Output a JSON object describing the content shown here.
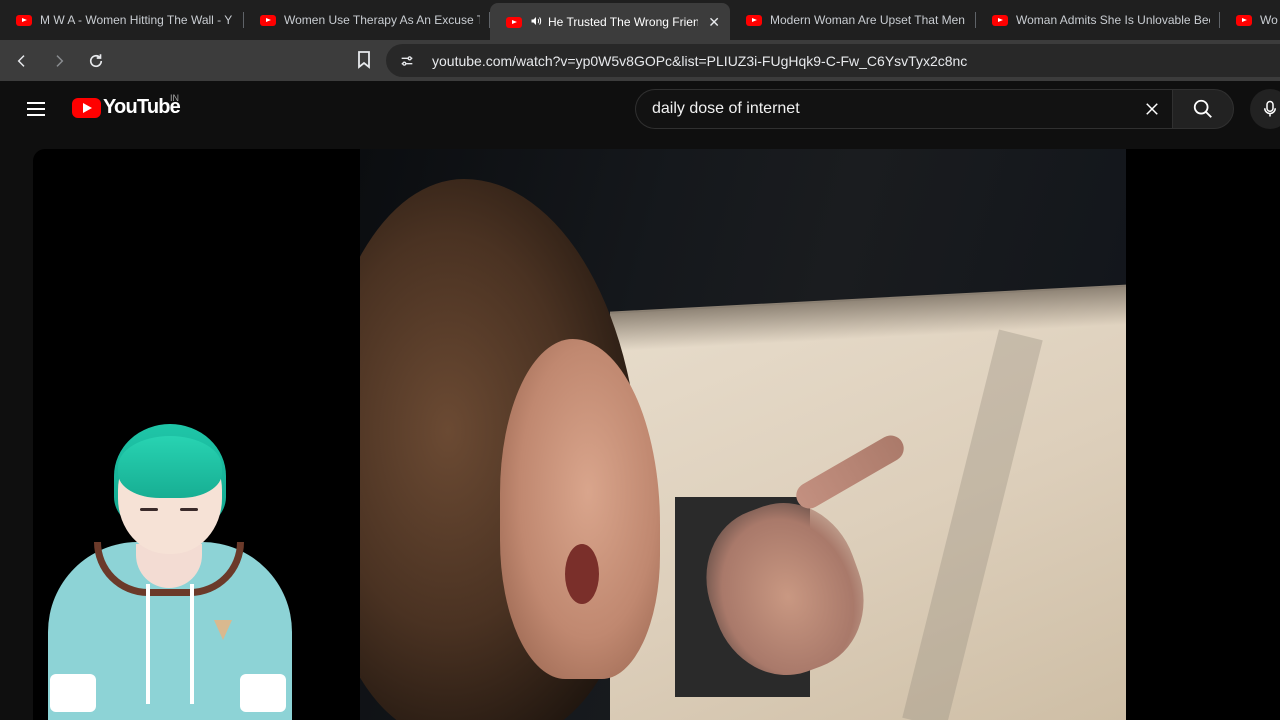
{
  "tabs": [
    {
      "title": "M W A - Women Hitting The Wall - Y",
      "active": false
    },
    {
      "title": "Women Use Therapy As An Excuse To",
      "active": false
    },
    {
      "title": "He Trusted The Wrong Friend",
      "active": true,
      "audio": true
    },
    {
      "title": "Modern Woman Are Upset That Men",
      "active": false
    },
    {
      "title": "Woman Admits She Is Unlovable Bec",
      "active": false
    },
    {
      "title": "Wo",
      "active": false
    }
  ],
  "address_bar": {
    "url": "youtube.com/watch?v=yp0W5v8GOPc&list=PLIUZ3i-FUgHqk9-C-Fw_C6YsvTyx2c8nc"
  },
  "youtube": {
    "logo_text": "YouTube",
    "country_code": "IN",
    "search_query": "daily dose of internet"
  },
  "colors": {
    "brand_red": "#ff0000",
    "page_bg": "#0f0f0f",
    "tabstrip_bg": "#1f1f1f",
    "toolbar_bg": "#3c3c3c"
  },
  "icons": {
    "back": "arrow-left-icon",
    "forward": "arrow-right-icon",
    "reload": "reload-icon",
    "bookmark": "bookmark-icon",
    "site_info": "tune-icon",
    "menu": "hamburger-icon",
    "clear": "close-icon",
    "search": "search-icon",
    "mic": "mic-icon"
  }
}
